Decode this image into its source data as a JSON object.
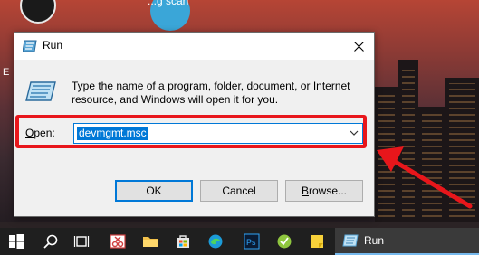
{
  "desktop": {
    "caption": "...g scan",
    "edge_label": "E"
  },
  "dialog": {
    "title": "Run",
    "prompt": "Type the name of a program, folder, document, or Internet resource, and Windows will open it for you.",
    "open_label_underlined": "O",
    "open_label_rest": "pen:",
    "open_value": "devmgmt.msc",
    "buttons": {
      "ok": "OK",
      "cancel": "Cancel",
      "browse_underlined": "B",
      "browse_rest": "rowse..."
    }
  },
  "taskbar": {
    "items": [
      "start-icon",
      "search-icon",
      "task-view-icon",
      "snipping-tool-icon",
      "file-explorer-icon",
      "store-icon",
      "edge-icon",
      "photoshop-icon",
      "app-icon",
      "sticky-notes-icon"
    ],
    "photoshop_label": "Ps",
    "run_label": "Run"
  },
  "colors": {
    "accent": "#0078d7",
    "annotation": "#e8161b",
    "taskbar": "#1f1f1f"
  }
}
